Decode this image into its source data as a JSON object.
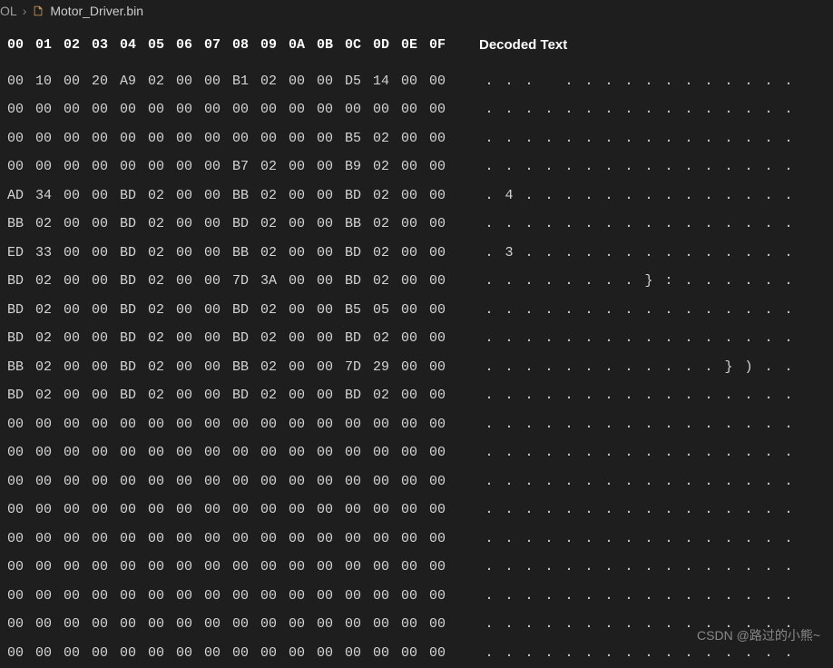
{
  "breadcrumb": {
    "parent": "OL",
    "filename": "Motor_Driver.bin"
  },
  "header": {
    "hexCols": [
      "00",
      "01",
      "02",
      "03",
      "04",
      "05",
      "06",
      "07",
      "08",
      "09",
      "0A",
      "0B",
      "0C",
      "0D",
      "0E",
      "0F"
    ],
    "decodedLabel": "Decoded Text"
  },
  "rows": [
    {
      "hex": [
        "00",
        "10",
        "00",
        "20",
        "A9",
        "02",
        "00",
        "00",
        "B1",
        "02",
        "00",
        "00",
        "D5",
        "14",
        "00",
        "00"
      ],
      "dec": [
        ".",
        ".",
        ".",
        " ",
        ".",
        ".",
        ".",
        ".",
        ".",
        ".",
        ".",
        ".",
        ".",
        ".",
        ".",
        "."
      ]
    },
    {
      "hex": [
        "00",
        "00",
        "00",
        "00",
        "00",
        "00",
        "00",
        "00",
        "00",
        "00",
        "00",
        "00",
        "00",
        "00",
        "00",
        "00"
      ],
      "dec": [
        ".",
        ".",
        ".",
        ".",
        ".",
        ".",
        ".",
        ".",
        ".",
        ".",
        ".",
        ".",
        ".",
        ".",
        ".",
        "."
      ]
    },
    {
      "hex": [
        "00",
        "00",
        "00",
        "00",
        "00",
        "00",
        "00",
        "00",
        "00",
        "00",
        "00",
        "00",
        "B5",
        "02",
        "00",
        "00"
      ],
      "dec": [
        ".",
        ".",
        ".",
        ".",
        ".",
        ".",
        ".",
        ".",
        ".",
        ".",
        ".",
        ".",
        ".",
        ".",
        ".",
        "."
      ]
    },
    {
      "hex": [
        "00",
        "00",
        "00",
        "00",
        "00",
        "00",
        "00",
        "00",
        "B7",
        "02",
        "00",
        "00",
        "B9",
        "02",
        "00",
        "00"
      ],
      "dec": [
        ".",
        ".",
        ".",
        ".",
        ".",
        ".",
        ".",
        ".",
        ".",
        ".",
        ".",
        ".",
        ".",
        ".",
        ".",
        "."
      ]
    },
    {
      "hex": [
        "AD",
        "34",
        "00",
        "00",
        "BD",
        "02",
        "00",
        "00",
        "BB",
        "02",
        "00",
        "00",
        "BD",
        "02",
        "00",
        "00"
      ],
      "dec": [
        ".",
        "4",
        ".",
        ".",
        ".",
        ".",
        ".",
        ".",
        ".",
        ".",
        ".",
        ".",
        ".",
        ".",
        ".",
        "."
      ]
    },
    {
      "hex": [
        "BB",
        "02",
        "00",
        "00",
        "BD",
        "02",
        "00",
        "00",
        "BD",
        "02",
        "00",
        "00",
        "BB",
        "02",
        "00",
        "00"
      ],
      "dec": [
        ".",
        ".",
        ".",
        ".",
        ".",
        ".",
        ".",
        ".",
        ".",
        ".",
        ".",
        ".",
        ".",
        ".",
        ".",
        "."
      ]
    },
    {
      "hex": [
        "ED",
        "33",
        "00",
        "00",
        "BD",
        "02",
        "00",
        "00",
        "BB",
        "02",
        "00",
        "00",
        "BD",
        "02",
        "00",
        "00"
      ],
      "dec": [
        ".",
        "3",
        ".",
        ".",
        ".",
        ".",
        ".",
        ".",
        ".",
        ".",
        ".",
        ".",
        ".",
        ".",
        ".",
        "."
      ]
    },
    {
      "hex": [
        "BD",
        "02",
        "00",
        "00",
        "BD",
        "02",
        "00",
        "00",
        "7D",
        "3A",
        "00",
        "00",
        "BD",
        "02",
        "00",
        "00"
      ],
      "dec": [
        ".",
        ".",
        ".",
        ".",
        ".",
        ".",
        ".",
        ".",
        "}",
        ":",
        ".",
        ".",
        ".",
        ".",
        ".",
        "."
      ]
    },
    {
      "hex": [
        "BD",
        "02",
        "00",
        "00",
        "BD",
        "02",
        "00",
        "00",
        "BD",
        "02",
        "00",
        "00",
        "B5",
        "05",
        "00",
        "00"
      ],
      "dec": [
        ".",
        ".",
        ".",
        ".",
        ".",
        ".",
        ".",
        ".",
        ".",
        ".",
        ".",
        ".",
        ".",
        ".",
        ".",
        "."
      ]
    },
    {
      "hex": [
        "BD",
        "02",
        "00",
        "00",
        "BD",
        "02",
        "00",
        "00",
        "BD",
        "02",
        "00",
        "00",
        "BD",
        "02",
        "00",
        "00"
      ],
      "dec": [
        ".",
        ".",
        ".",
        ".",
        ".",
        ".",
        ".",
        ".",
        ".",
        ".",
        ".",
        ".",
        ".",
        ".",
        ".",
        "."
      ]
    },
    {
      "hex": [
        "BB",
        "02",
        "00",
        "00",
        "BD",
        "02",
        "00",
        "00",
        "BB",
        "02",
        "00",
        "00",
        "7D",
        "29",
        "00",
        "00"
      ],
      "dec": [
        ".",
        ".",
        ".",
        ".",
        ".",
        ".",
        ".",
        ".",
        ".",
        ".",
        ".",
        ".",
        "}",
        ")",
        ".",
        "."
      ]
    },
    {
      "hex": [
        "BD",
        "02",
        "00",
        "00",
        "BD",
        "02",
        "00",
        "00",
        "BD",
        "02",
        "00",
        "00",
        "BD",
        "02",
        "00",
        "00"
      ],
      "dec": [
        ".",
        ".",
        ".",
        ".",
        ".",
        ".",
        ".",
        ".",
        ".",
        ".",
        ".",
        ".",
        ".",
        ".",
        ".",
        "."
      ]
    },
    {
      "hex": [
        "00",
        "00",
        "00",
        "00",
        "00",
        "00",
        "00",
        "00",
        "00",
        "00",
        "00",
        "00",
        "00",
        "00",
        "00",
        "00"
      ],
      "dec": [
        ".",
        ".",
        ".",
        ".",
        ".",
        ".",
        ".",
        ".",
        ".",
        ".",
        ".",
        ".",
        ".",
        ".",
        ".",
        "."
      ]
    },
    {
      "hex": [
        "00",
        "00",
        "00",
        "00",
        "00",
        "00",
        "00",
        "00",
        "00",
        "00",
        "00",
        "00",
        "00",
        "00",
        "00",
        "00"
      ],
      "dec": [
        ".",
        ".",
        ".",
        ".",
        ".",
        ".",
        ".",
        ".",
        ".",
        ".",
        ".",
        ".",
        ".",
        ".",
        ".",
        "."
      ]
    },
    {
      "hex": [
        "00",
        "00",
        "00",
        "00",
        "00",
        "00",
        "00",
        "00",
        "00",
        "00",
        "00",
        "00",
        "00",
        "00",
        "00",
        "00"
      ],
      "dec": [
        ".",
        ".",
        ".",
        ".",
        ".",
        ".",
        ".",
        ".",
        ".",
        ".",
        ".",
        ".",
        ".",
        ".",
        ".",
        "."
      ]
    },
    {
      "hex": [
        "00",
        "00",
        "00",
        "00",
        "00",
        "00",
        "00",
        "00",
        "00",
        "00",
        "00",
        "00",
        "00",
        "00",
        "00",
        "00"
      ],
      "dec": [
        ".",
        ".",
        ".",
        ".",
        ".",
        ".",
        ".",
        ".",
        ".",
        ".",
        ".",
        ".",
        ".",
        ".",
        ".",
        "."
      ]
    },
    {
      "hex": [
        "00",
        "00",
        "00",
        "00",
        "00",
        "00",
        "00",
        "00",
        "00",
        "00",
        "00",
        "00",
        "00",
        "00",
        "00",
        "00"
      ],
      "dec": [
        ".",
        ".",
        ".",
        ".",
        ".",
        ".",
        ".",
        ".",
        ".",
        ".",
        ".",
        ".",
        ".",
        ".",
        ".",
        "."
      ]
    },
    {
      "hex": [
        "00",
        "00",
        "00",
        "00",
        "00",
        "00",
        "00",
        "00",
        "00",
        "00",
        "00",
        "00",
        "00",
        "00",
        "00",
        "00"
      ],
      "dec": [
        ".",
        ".",
        ".",
        ".",
        ".",
        ".",
        ".",
        ".",
        ".",
        ".",
        ".",
        ".",
        ".",
        ".",
        ".",
        "."
      ]
    },
    {
      "hex": [
        "00",
        "00",
        "00",
        "00",
        "00",
        "00",
        "00",
        "00",
        "00",
        "00",
        "00",
        "00",
        "00",
        "00",
        "00",
        "00"
      ],
      "dec": [
        ".",
        ".",
        ".",
        ".",
        ".",
        ".",
        ".",
        ".",
        ".",
        ".",
        ".",
        ".",
        ".",
        ".",
        ".",
        "."
      ]
    },
    {
      "hex": [
        "00",
        "00",
        "00",
        "00",
        "00",
        "00",
        "00",
        "00",
        "00",
        "00",
        "00",
        "00",
        "00",
        "00",
        "00",
        "00"
      ],
      "dec": [
        ".",
        ".",
        ".",
        ".",
        ".",
        ".",
        ".",
        ".",
        ".",
        ".",
        ".",
        ".",
        ".",
        ".",
        ".",
        "."
      ]
    },
    {
      "hex": [
        "00",
        "00",
        "00",
        "00",
        "00",
        "00",
        "00",
        "00",
        "00",
        "00",
        "00",
        "00",
        "00",
        "00",
        "00",
        "00"
      ],
      "dec": [
        ".",
        ".",
        ".",
        ".",
        ".",
        ".",
        ".",
        ".",
        ".",
        ".",
        ".",
        ".",
        ".",
        ".",
        ".",
        "."
      ]
    }
  ],
  "watermark": "CSDN @路过的小熊~"
}
